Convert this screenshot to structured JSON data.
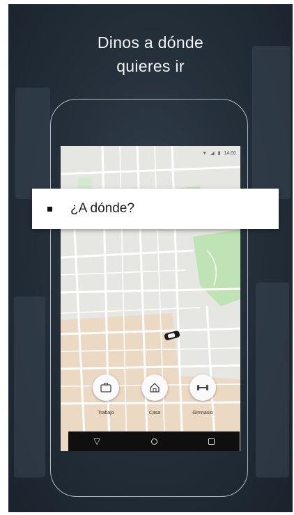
{
  "headline": {
    "line1": "Dinos a dónde",
    "line2": "quieres ir"
  },
  "status_bar": {
    "time": "14:00"
  },
  "search": {
    "placeholder": "¿A dónde?"
  },
  "shortcuts": [
    {
      "label": "Trabajo",
      "icon": "briefcase-icon"
    },
    {
      "label": "Casa",
      "icon": "home-icon"
    },
    {
      "label": "Gimnasio",
      "icon": "dumbbell-icon"
    }
  ],
  "navigation": {
    "icons": [
      "back-triangle-icon",
      "home-circle-icon",
      "recents-square-icon"
    ]
  },
  "colors": {
    "background_dark": "#25303b",
    "map_base": "#e6e6e3",
    "map_park": "#bfe3b4",
    "map_beige": "#ecd9c4",
    "search_card": "#ffffff",
    "nav_bar": "#0f0f0f"
  }
}
